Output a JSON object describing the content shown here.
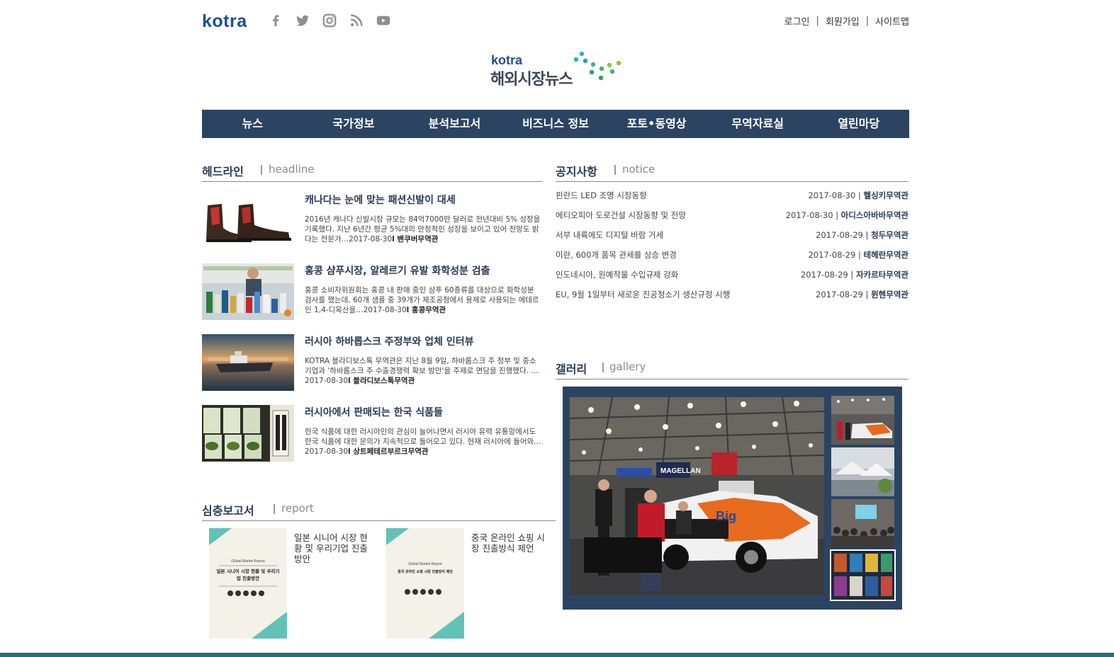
{
  "brand": "kotra",
  "social": [
    "facebook-icon",
    "twitter-icon",
    "instagram-icon",
    "rss-icon",
    "youtube-icon"
  ],
  "util_links": [
    "로그인",
    "회원가입",
    "사이트맵"
  ],
  "util_sep": "|",
  "logo": {
    "top": "kotra",
    "title": "해외시장뉴스"
  },
  "nav": [
    "뉴스",
    "국가정보",
    "분석보고서",
    "비즈니스 정보",
    "포토•동영상",
    "무역자료실",
    "열린마당"
  ],
  "headline": {
    "ko": "헤드라인",
    "en": "headline",
    "items": [
      {
        "title": "캐나다는 눈에 맞는 패션신발이 대세",
        "desc": "2016년 캐나다 신발시장 규모는 84억7000만 달러로 전년대비 5% 성장을 기록했다. 지난 6년간 평균 5%대의 안정적인 성장을 보이고 있어 전망도 밝다는 전문가…2017-08-30",
        "office": "l 밴쿠버무역관"
      },
      {
        "title": "홍콩 샴푸시장, 알레르기 유발 화학성분 검출",
        "desc": "홍콩 소비자위원회는 홍콩 내 판매 중인 샴푸 60종류를 대상으로 화학성분 검사를 했는데, 60개 샘플 중 39개가 제조공정에서 용제로 사용되는 에테르인 1,4-디옥산을…2017-08-30",
        "office": "l 홍콩무역관"
      },
      {
        "title": "러시아 하바롭스크 주정부와 업체 인터뷰",
        "desc": "KOTRA 블라디보스톡 무역관은 지난 8월 9일, 하바롭스크 주 정부 및 중소기업과 '하바롭스크 주 수출경쟁력 확보 방안'을 주제로 면담을 진행했다. …2017-08-30",
        "office": "l 블라디보스톡무역관"
      },
      {
        "title": "러시아에서 판매되는 한국 식품들",
        "desc": "한국 식품에 대한 러시아인의 관심이 늘어나면서 러시아 유력 유통망에서도 한국 식품에 대한 문의가 지속적으로 들어오고 있다. 현재 러시아에 들어와…2017-08-30",
        "office": "l 상트페테르부르크무역관"
      }
    ]
  },
  "notice": {
    "ko": "공지사항",
    "en": "notice",
    "items": [
      {
        "title": "핀란드 LED 조명 시장동향",
        "date": "2017-08-30 | ",
        "office": "헬싱키무역관"
      },
      {
        "title": "에티오피아 도로건설 시장동향 및 전망",
        "date": "2017-08-30 | ",
        "office": "아디스아바바무역관"
      },
      {
        "title": "서부 내륙에도 디지털 바람 거세",
        "date": "2017-08-29 | ",
        "office": "청두무역관"
      },
      {
        "title": "이란, 600개 품목 관세를 상승 변경",
        "date": "2017-08-29 | ",
        "office": "테헤란무역관"
      },
      {
        "title": "인도네시아, 원예작물 수입규제 강화",
        "date": "2017-08-29 | ",
        "office": "자카르타무역관"
      },
      {
        "title": "EU, 9월 1일부터 새로운 진공청소기 생산규정 시행",
        "date": "2017-08-29 | ",
        "office": "뮌헨무역관"
      }
    ]
  },
  "gallery": {
    "ko": "갤러리",
    "en": "gallery",
    "main_sign_1": "MAGELLAN",
    "main_sign_2": "Big"
  },
  "report": {
    "ko": "심층보고서",
    "en": "report",
    "items": [
      {
        "title": "일본 시니어 시장 현황 및 우리기업 진출방안",
        "cover_top": "Global Market Report",
        "cover_title": "일본 시니어 시장 현황 및 우리기업 진출방안"
      },
      {
        "title": "중국 온라인 쇼핑 시장 진출방식 제언",
        "cover_top": "Global Market Report",
        "cover_title": "중국 온라인 쇼핑 시장 진출방식 제언"
      }
    ]
  },
  "colors": {
    "nav_bg": "#2b4462",
    "brand": "#1c4f93",
    "footer": "#2e6e6e"
  }
}
